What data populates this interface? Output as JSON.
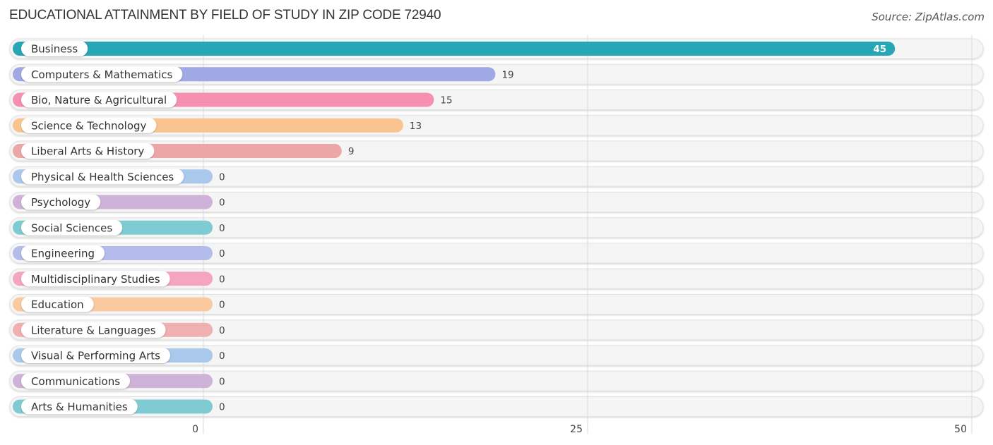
{
  "header": {
    "title": "EDUCATIONAL ATTAINMENT BY FIELD OF STUDY IN ZIP CODE 72940",
    "source": "Source: ZipAtlas.com"
  },
  "chart_data": {
    "type": "bar",
    "orientation": "horizontal",
    "title": "EDUCATIONAL ATTAINMENT BY FIELD OF STUDY IN ZIP CODE 72940",
    "xlabel": "",
    "ylabel": "",
    "xlim": [
      0,
      50
    ],
    "xticks": [
      0,
      25,
      50
    ],
    "grid": true,
    "categories": [
      "Business",
      "Computers & Mathematics",
      "Bio, Nature & Agricultural",
      "Science & Technology",
      "Liberal Arts & History",
      "Physical & Health Sciences",
      "Psychology",
      "Social Sciences",
      "Engineering",
      "Multidisciplinary Studies",
      "Education",
      "Literature & Languages",
      "Visual & Performing Arts",
      "Communications",
      "Arts & Humanities"
    ],
    "values": [
      45,
      19,
      15,
      13,
      9,
      0,
      0,
      0,
      0,
      0,
      0,
      0,
      0,
      0,
      0
    ],
    "colors": [
      "#27a6b5",
      "#a0a9e3",
      "#f590b0",
      "#f9c48f",
      "#eda6a6",
      "#a9c8ec",
      "#cfb2d8",
      "#7fcbd2",
      "#b4bcec",
      "#f5a5c0",
      "#fac9a0",
      "#f0b0b0",
      "#a9c8ec",
      "#cfb2d8",
      "#80cbd3"
    ]
  }
}
